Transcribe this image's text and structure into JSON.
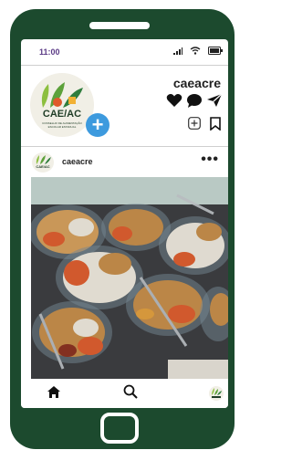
{
  "status_bar": {
    "time": "11:00"
  },
  "profile": {
    "username": "caeacre",
    "avatar_text": "CAE/AC",
    "avatar_subtext": "CONSELHO DE ALIMENTAÇÃO ESCOLAR ESTADUAL"
  },
  "post": {
    "username": "caeacre",
    "more_label": "•••"
  },
  "icons": {
    "signal": "signal-icon",
    "wifi": "wifi-icon",
    "battery": "battery-icon",
    "heart": "heart-icon",
    "comment": "comment-icon",
    "share": "send-icon",
    "add": "add-square-icon",
    "bookmark": "bookmark-icon",
    "home": "home-icon",
    "search": "search-icon"
  },
  "colors": {
    "phone_frame": "#1c4a2e",
    "accent_blue": "#3d9ade",
    "time_purple": "#5b3b86"
  }
}
